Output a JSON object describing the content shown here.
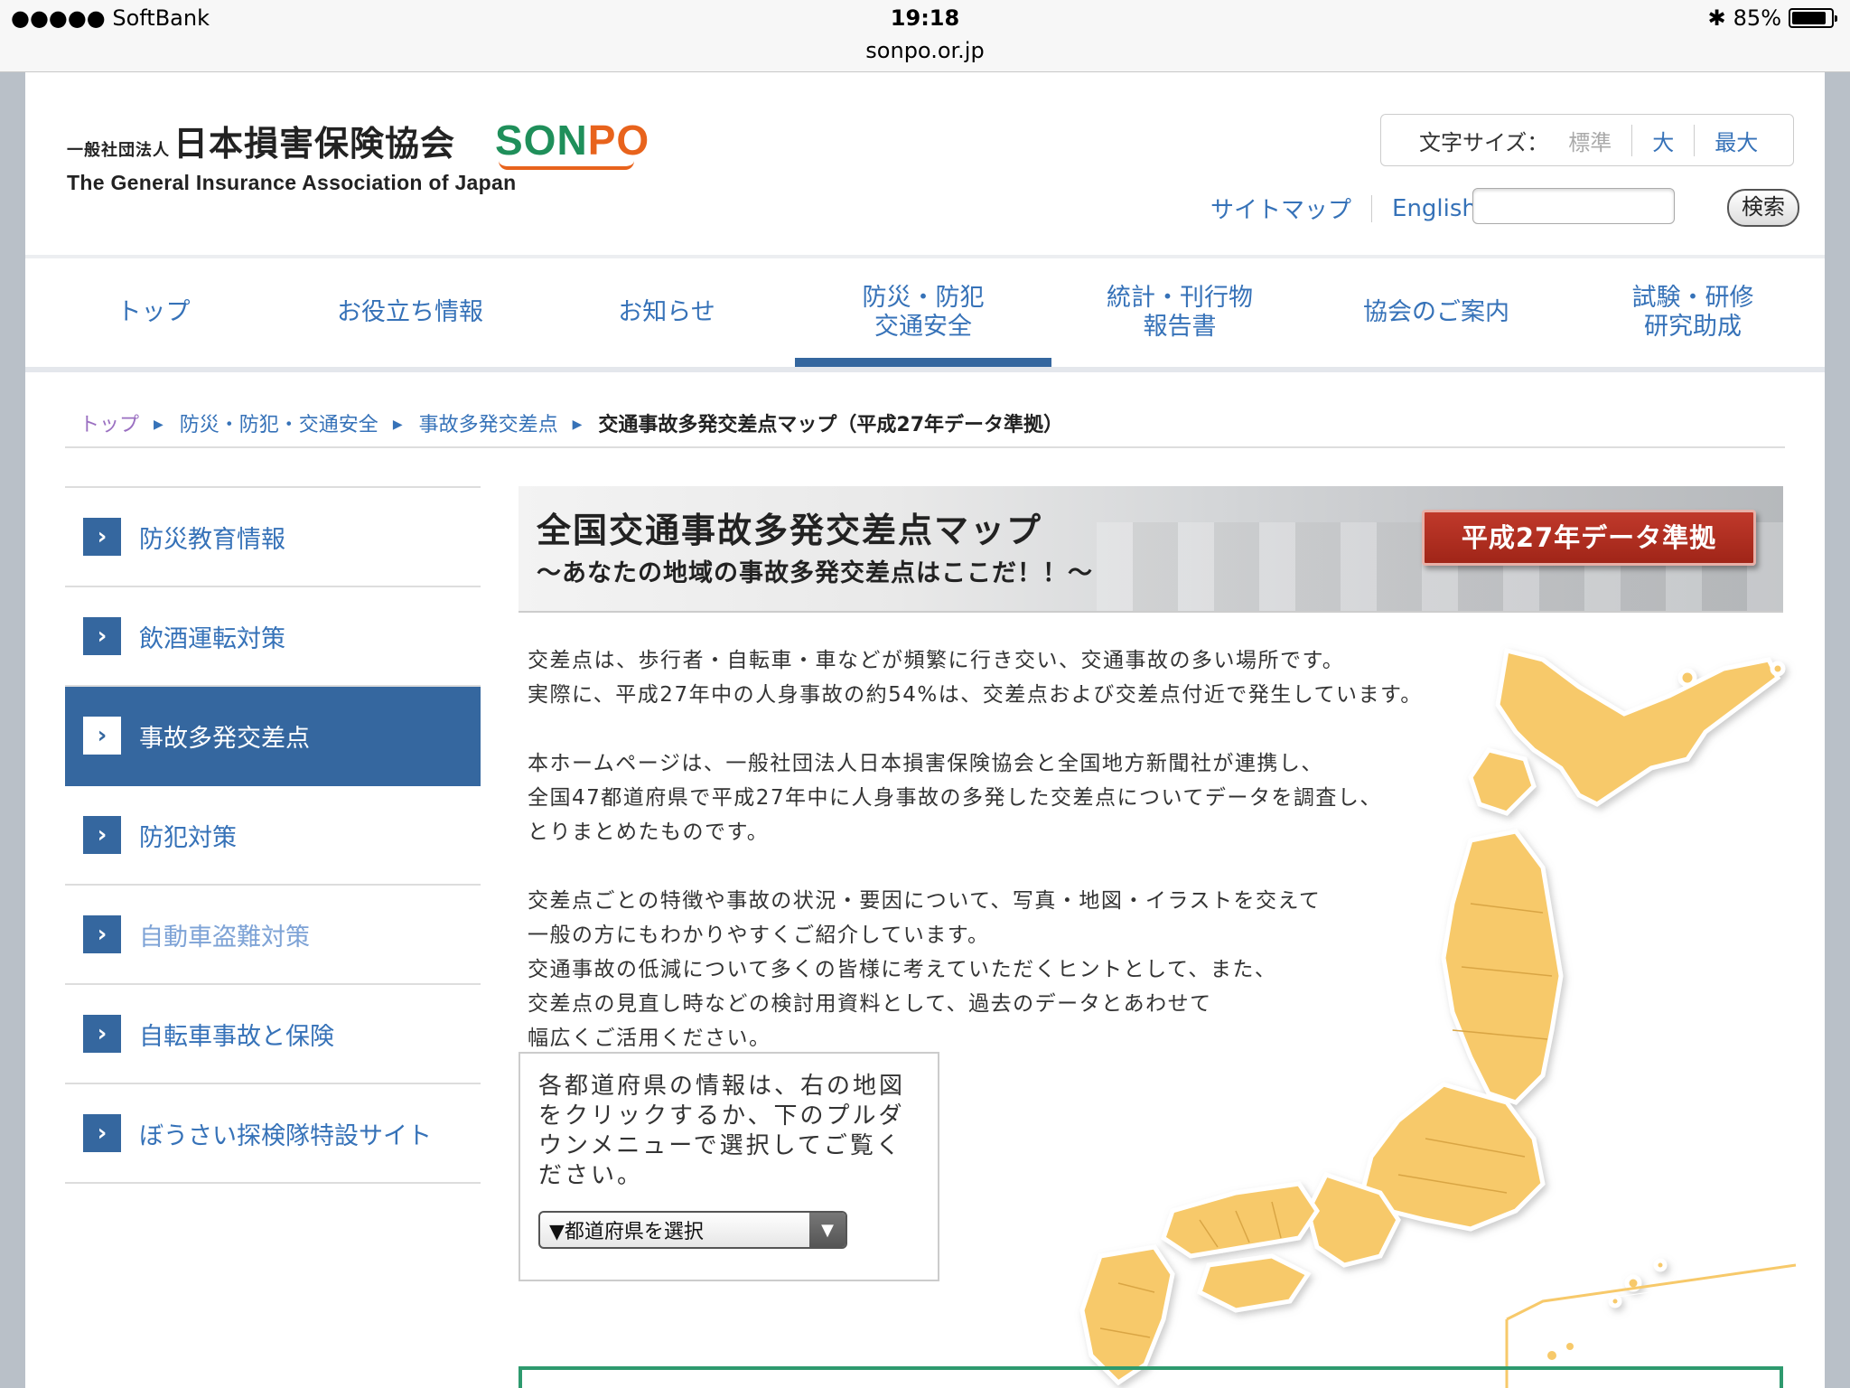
{
  "status_bar": {
    "carrier": "●●●●● SoftBank",
    "time": "19:18",
    "url": "sonpo.or.jp",
    "battery": "85%",
    "battery_level": 0.85
  },
  "header": {
    "org_prefix": "一般社団法人",
    "org_name": "日本損害保険協会",
    "org_english": "The General Insurance Association of Japan",
    "brand_part1": "SON",
    "brand_part2": "PO",
    "brand_colors": {
      "green": "#1f8f5a",
      "orange": "#e8631c"
    },
    "font_size_label": "文字サイズ：",
    "font_size_options": [
      "標準",
      "大",
      "最大"
    ],
    "sitemap_label": "サイトマップ",
    "english_label": "English",
    "search_placeholder": "",
    "search_button": "検索"
  },
  "global_nav": [
    {
      "label": "トップ"
    },
    {
      "label": "お役立ち情報"
    },
    {
      "label": "お知らせ"
    },
    {
      "label": "防災・防犯\n交通安全",
      "active": true
    },
    {
      "label": "統計・刊行物\n報告書"
    },
    {
      "label": "協会のご案内"
    },
    {
      "label": "試験・研修\n研究助成"
    }
  ],
  "breadcrumb": [
    "トップ",
    "防災・防犯・交通安全",
    "事故多発交差点",
    "交通事故多発交差点マップ（平成27年データ準拠）"
  ],
  "side_nav": [
    {
      "label": "防災教育情報"
    },
    {
      "label": "飲酒運転対策"
    },
    {
      "label": "事故多発交差点",
      "active": true
    },
    {
      "label": "防犯対策"
    },
    {
      "label": "自動車盗難対策",
      "dim": true
    },
    {
      "label": "自転車事故と保険"
    },
    {
      "label": "ぼうさい探検隊特設サイト"
    }
  ],
  "banner": {
    "title": "全国交通事故多発交差点マップ",
    "subtitle": "～あなたの地域の事故多発交差点はここだ！！～",
    "badge": "平成27年データ準拠"
  },
  "intro": {
    "p1": "交差点は、歩行者・自転車・車などが頻繁に行き交い、交通事故の多い場所です。\n実際に、平成27年中の人身事故の約54%は、交差点および交差点付近で発生しています。",
    "p2": "本ホームページは、一般社団法人日本損害保険協会と全国地方新聞社が連携し、\n全国47都道府県で平成27年中に人身事故の多発した交差点についてデータを調査し、\nとりまとめたものです。",
    "p3": "交差点ごとの特徴や事故の状況・要因について、写真・地図・イラストを交えて\n一般の方にもわかりやすくご紹介しています。\n交通事故の低減について多くの皆様に考えていただくヒントとして、また、\n交差点の見直し時などの検討用資料として、過去のデータとあわせて\n幅広くご活用ください。"
  },
  "infobox": {
    "text": "各都道府県の情報は、右の地図をクリックするか、下のプルダウンメニューで選択してご覧ください。",
    "select_value": "▼都道府県を選択"
  },
  "colors": {
    "link": "#3672b8",
    "nav_active": "#35679f",
    "map_fill": "#f7c96a",
    "badge": "#b02e20"
  }
}
